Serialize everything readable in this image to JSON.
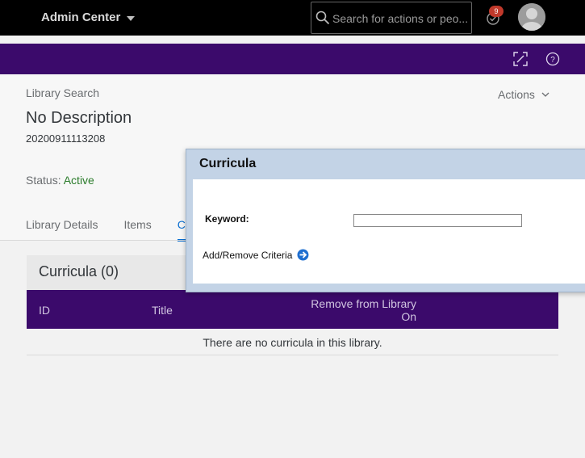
{
  "topbar": {
    "app_title": "Admin Center",
    "search_placeholder": "Search for actions or peo...",
    "notification_count": "9"
  },
  "page": {
    "breadcrumb": "Library Search",
    "title": "No Description",
    "id": "20200911113208",
    "actions_label": "Actions",
    "status_label": "Status:",
    "status_value": "Active"
  },
  "tabs": [
    {
      "label": "Library Details"
    },
    {
      "label": "Items"
    },
    {
      "label": "Cu"
    }
  ],
  "section": {
    "title": "Curricula (0)",
    "columns": [
      "ID",
      "Title",
      "Remove from Library",
      "On"
    ],
    "empty_message": "There are no curricula in this library."
  },
  "dialog": {
    "title": "Curricula",
    "keyword_label": "Keyword:",
    "keyword_value": "",
    "criteria_label": "Add/Remove Criteria"
  },
  "colors": {
    "brand_purple": "#3b0a6b",
    "status_green": "#2b7c2b",
    "active_tab": "#0a6ed1",
    "dialog_header": "#c3d3e6"
  },
  "icons": [
    "caret-down-icon",
    "search-icon",
    "notification-icon",
    "avatar-icon",
    "expand-icon",
    "help-icon",
    "chevron-down-icon",
    "arrow-right-circle-icon"
  ]
}
